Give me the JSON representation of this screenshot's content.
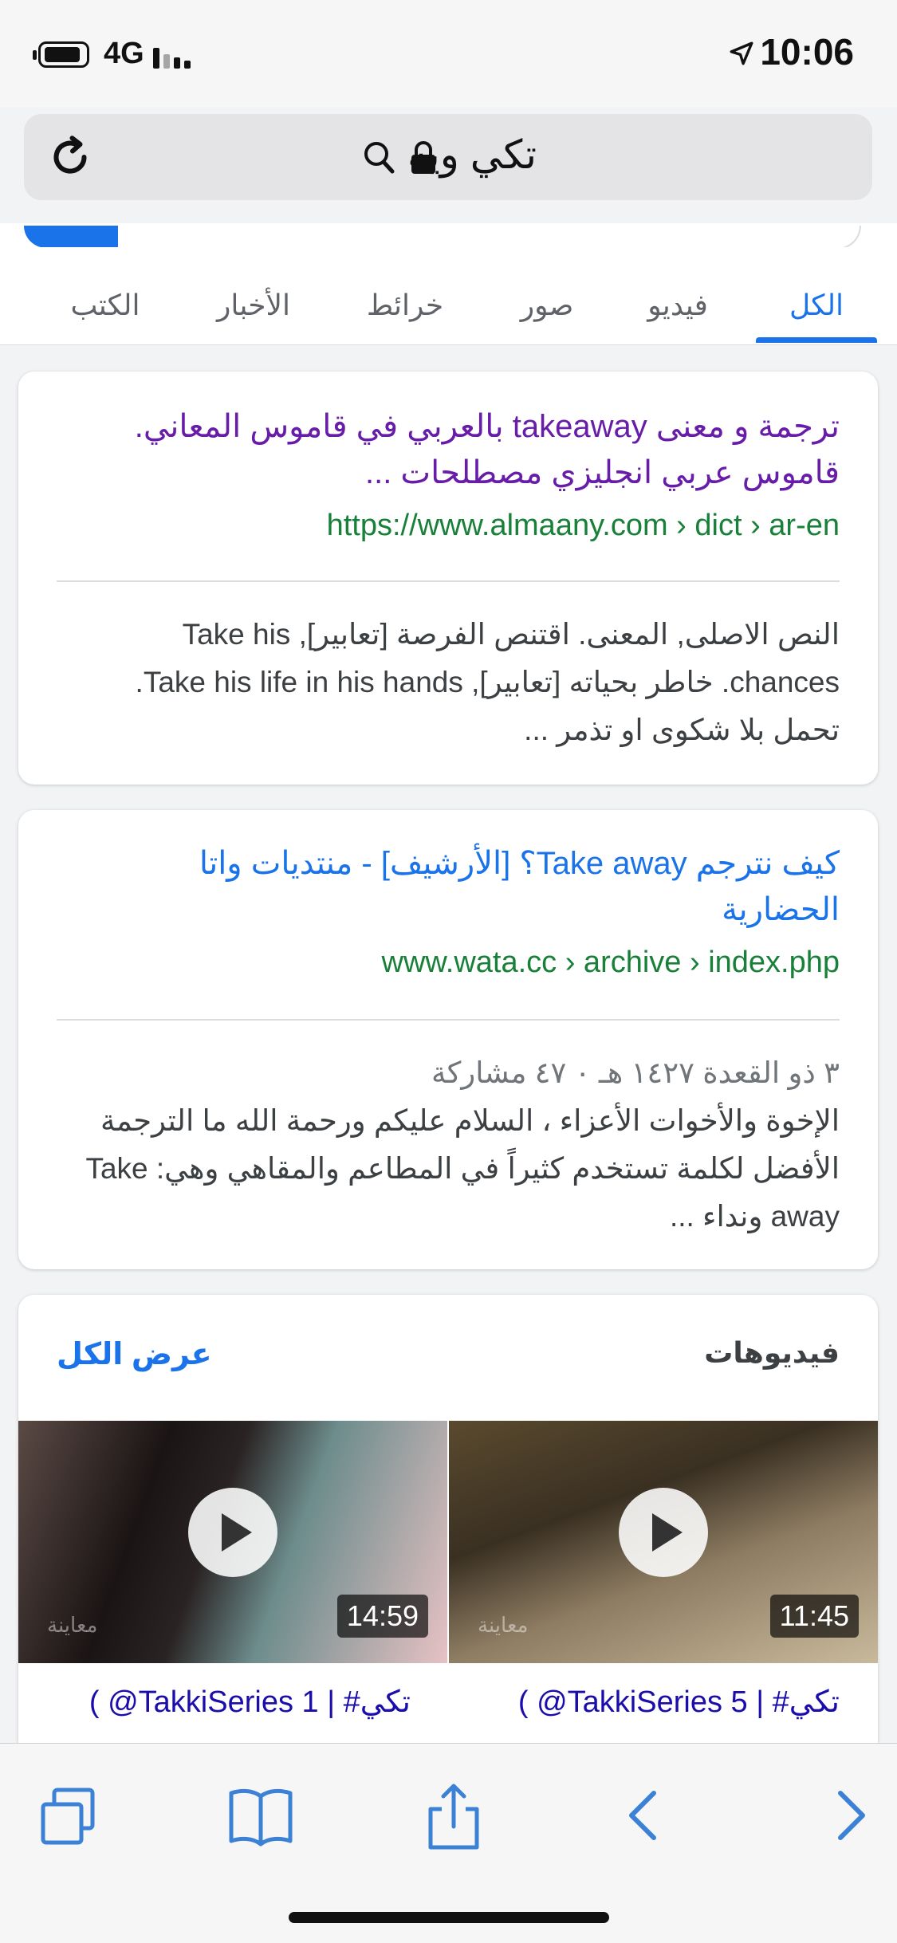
{
  "status_bar": {
    "network": "4G",
    "time": "10:06"
  },
  "address_bar": {
    "query": "تكي ويه"
  },
  "tabs": [
    {
      "label": "الكل",
      "active": true
    },
    {
      "label": "فيديو",
      "active": false
    },
    {
      "label": "صور",
      "active": false
    },
    {
      "label": "خرائط",
      "active": false
    },
    {
      "label": "الأخبار",
      "active": false
    },
    {
      "label": "الكتب",
      "active": false
    }
  ],
  "results": [
    {
      "title_line1": "ترجمة و معنى takeaway بالعربي في قاموس المعاني.",
      "title_line2": "قاموس عربي انجليزي مصطلحات ...",
      "url": "https://www.almaany.com › dict › ar-en",
      "snippet_line1": "النص الاصلى, المعنى. اقتنص الفرصة [تعابير], Take his",
      "snippet_line2": "chances. خاطر بحياته [تعابير], Take his life in his hands.",
      "snippet_line3": "تحمل بلا شكوى او تذمر ..."
    },
    {
      "title_line1": "كيف نترجم Take away؟ [الأرشيف] - منتديات واتا",
      "title_line2": "الحضارية",
      "url": "www.wata.cc › archive › index.php",
      "meta": "٣ ذو القعدة ١٤٢٧ هـ ٠ ٤٧ مشاركة",
      "snippet_line1": "الإخوة والأخوات الأعزاء ، السلام عليكم ورحمة الله ما الترجمة",
      "snippet_line2": "الأفضل لكلمة تستخدم كثيراً في المطاعم والمقاهي وهي: Take",
      "snippet_line3": "away ونداء ..."
    }
  ],
  "videos": {
    "heading": "فيديوهات",
    "show_all": "عرض الكل",
    "items": [
      {
        "duration": "11:45",
        "watermark": "معاينة",
        "title": "( @TakkiSeries 5 | #تكي"
      },
      {
        "duration": "14:59",
        "watermark": "معاينة",
        "title": "( @TakkiSeries 1 | #تكي"
      }
    ]
  },
  "colors": {
    "accent": "#1a73e8",
    "visited_link": "#681da8",
    "link": "#1a0dab",
    "url_green": "#188038"
  }
}
